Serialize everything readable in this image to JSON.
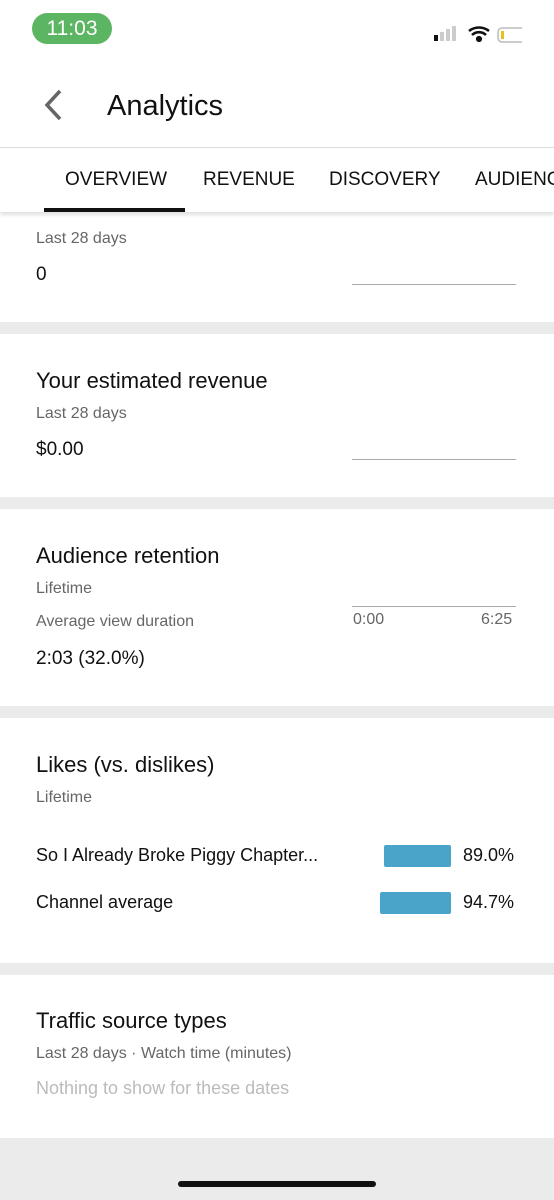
{
  "status": {
    "time": "11:03",
    "icons": [
      "signal-icon",
      "wifi-icon",
      "battery-icon"
    ]
  },
  "header": {
    "title": "Analytics"
  },
  "tabs": [
    "OVERVIEW",
    "REVENUE",
    "DISCOVERY",
    "AUDIENCE"
  ],
  "cards": {
    "views": {
      "period": "Last 28 days",
      "value": "0"
    },
    "revenue": {
      "title": "Your estimated revenue",
      "period": "Last 28 days",
      "value": "$0.00"
    },
    "retention": {
      "title": "Audience retention",
      "period": "Lifetime",
      "label": "Average view duration",
      "value": "2:03 (32.0%)",
      "axis_start": "0:00",
      "axis_end": "6:25"
    },
    "likes": {
      "title": "Likes (vs. dislikes)",
      "period": "Lifetime",
      "rows": [
        {
          "label": "So I Already Broke Piggy Chapter...",
          "pct": "89.0%",
          "value": 89.0
        },
        {
          "label": "Channel average",
          "pct": "94.7%",
          "value": 94.7
        }
      ],
      "bar_color": "#4aa3c9"
    },
    "traffic": {
      "title": "Traffic source types",
      "period": "Last 28 days · Watch time (minutes)",
      "empty": "Nothing to show for these dates"
    }
  }
}
